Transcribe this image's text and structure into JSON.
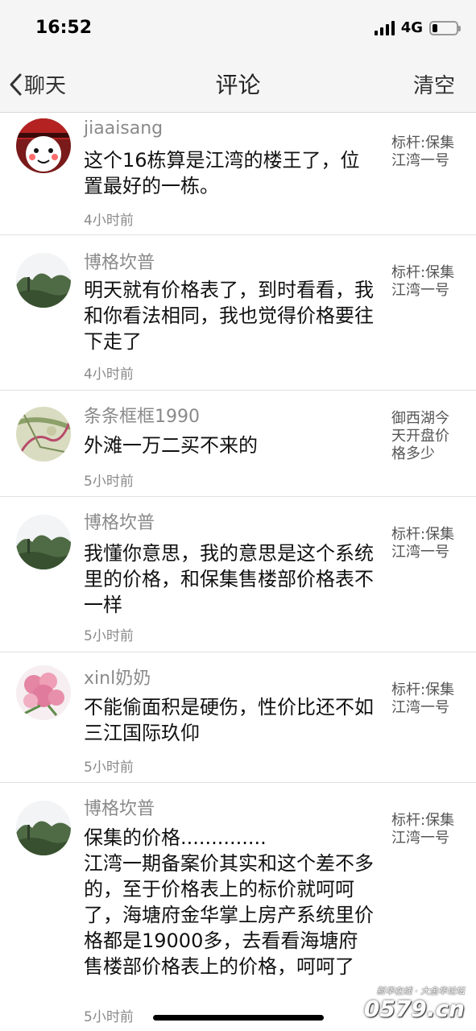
{
  "status": {
    "time": "16:52",
    "network": "4G",
    "battery_level": 0.2
  },
  "nav": {
    "back_label": "聊天",
    "title": "评论",
    "action": "清空"
  },
  "comments": [
    {
      "user": "jiaaisang",
      "text": "这个16栋算是江湾的楼王了，位置最好的一栋。",
      "time": "4小时前",
      "topic": "标杆:保集江湾一号",
      "avatar": "cartoon-avatar"
    },
    {
      "user": "博格坎普",
      "text": "明天就有价格表了，到时看看，我和你看法相同，我也觉得价格要往下走了",
      "time": "4小时前",
      "topic": "标杆:保集江湾一号",
      "avatar": "landscape-avatar"
    },
    {
      "user": "条条框框1990",
      "text": "外滩一万二买不来的",
      "time": "5小时前",
      "topic": "御西湖今天开盘价格多少",
      "avatar": "map-avatar"
    },
    {
      "user": "博格坎普",
      "text": "我懂你意思，我的意思是这个系统里的价格，和保集售楼部价格表不一样",
      "time": "5小时前",
      "topic": "标杆:保集江湾一号",
      "avatar": "landscape-avatar"
    },
    {
      "user": "xinl奶奶",
      "text": "不能偷面积是硬伤，性价比还不如三江国际玖仰",
      "time": "5小时前",
      "topic": "标杆:保集江湾一号",
      "avatar": "flower-avatar"
    },
    {
      "user": "博格坎普",
      "text": "保集的价格..............\n江湾一期备案价其实和这个差不多的，至于价格表上的标价就呵呵了，海塘府金华掌上房产系统里价格都是19000多，去看看海塘府售楼部价格表上的价格，呵呵了",
      "time": "5小时前",
      "topic": "标杆:保集江湾一号",
      "avatar": "landscape-avatar"
    }
  ],
  "watermark": {
    "small": "新华在线 · 大金华论坛",
    "big": "0579.cn"
  }
}
